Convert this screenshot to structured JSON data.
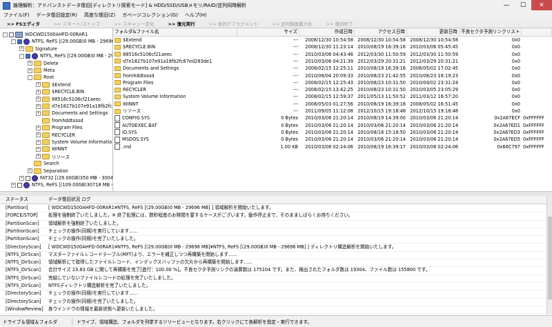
{
  "window": {
    "title": "論理解析：アドバンストデータ復旧[ディレクトリ探索モード] & HDD/SSD/USBメモリ/RAID/並列同時解析",
    "minimize": "—",
    "maximize": "☐",
    "close": "✕"
  },
  "menu": [
    "ファイル(F)",
    "データ復旧設定(R)",
    "高度な復旧(Z)",
    "ガベージコレクション(G)",
    "ヘルプ(H)"
  ],
  "toolbar": [
    {
      "label": ">> FSエディタ",
      "active": true
    },
    {
      "label": ">> スタート/ストップ",
      "active": false
    },
    {
      "label": ">> スキャン一定化",
      "active": false
    },
    {
      "label": ">> 復元実行",
      "active": true
    },
    {
      "label": ">> 並列デフラグメント",
      "active": false
    },
    {
      "label": ">> 並列階層最大化",
      "active": false
    },
    {
      "label": ">> 復旧終了",
      "active": false
    }
  ],
  "tree": [
    {
      "label": "WDCWD1500AHFD-00RAR1",
      "level": 0,
      "type": "drive",
      "pm": "-"
    },
    {
      "label": "NTFS, ReFS [(29.00GB)0 MB - 29696",
      "level": 1,
      "type": "part",
      "pm": "-",
      "checked": true
    },
    {
      "label": "Signature",
      "level": 2,
      "type": "folder",
      "pm": "+"
    },
    {
      "label": "NTFS, ReFS [(29.00GB)0 MB - 296",
      "level": 2,
      "type": "part",
      "pm": "-",
      "checked": true
    },
    {
      "label": "Delete",
      "level": 3,
      "type": "folder",
      "pm": "+"
    },
    {
      "label": "Meta",
      "level": 3,
      "type": "folder",
      "pm": "+"
    },
    {
      "label": "Root",
      "level": 3,
      "type": "folder",
      "pm": "-"
    },
    {
      "label": "$Extend",
      "level": 4,
      "type": "folder",
      "pm": "+"
    },
    {
      "label": "$RECYCLE.BIN",
      "level": 4,
      "type": "folder",
      "pm": "+"
    },
    {
      "label": "88516c5106cf21aeec",
      "level": 4,
      "type": "folder",
      "pm": "+"
    },
    {
      "label": "d7e1827b107e91a18fb2fc67",
      "level": 4,
      "type": "folder",
      "pm": "+"
    },
    {
      "label": "Documents and Settings",
      "level": 4,
      "type": "folder",
      "pm": "+"
    },
    {
      "label": "fromhddtossd",
      "level": 4,
      "type": "folder",
      "pm": ""
    },
    {
      "label": "Program Files",
      "level": 4,
      "type": "folder",
      "pm": "+"
    },
    {
      "label": "RECYCLER",
      "level": 4,
      "type": "folder",
      "pm": "+"
    },
    {
      "label": "System Volume Informatio",
      "level": 4,
      "type": "folder",
      "pm": "+"
    },
    {
      "label": "WINNT",
      "level": 4,
      "type": "folder",
      "pm": "+"
    },
    {
      "label": "リソース",
      "level": 4,
      "type": "folder",
      "pm": "+"
    },
    {
      "label": "Search",
      "level": 3,
      "type": "folder",
      "pm": ""
    },
    {
      "label": "Separation",
      "level": 3,
      "type": "folder",
      "pm": "+"
    },
    {
      "label": "FAT32 [(29.00GB)350 MB - 30046",
      "level": 2,
      "type": "part",
      "pm": "+",
      "checked": false
    },
    {
      "label": "NTFS, ReFS [(109.00GB)30718 MB -",
      "level": 1,
      "type": "part",
      "pm": "+",
      "checked": false
    }
  ],
  "filelist": {
    "headers": [
      "フォルダ&ファイル名",
      "サイズ",
      "作成日時",
      "アクセス日時",
      "更新日時",
      "不良セクタ予測リンクリスト",
      ""
    ],
    "rows": [
      {
        "icon": "folder",
        "name": "$Extend",
        "size": "---",
        "created": "2008/12/30 10:54:58",
        "accessed": "2008/12/30 10:54:58",
        "modified": "2008/12/30 10:54:58",
        "bad": "0x0",
        "extra": ""
      },
      {
        "icon": "folder",
        "name": "$RECYCLE.BIN",
        "size": "---",
        "created": "2008/12/30 11:23:14",
        "accessed": "2010/08/19 16:39:16",
        "modified": "2010/03/06 05:45:45",
        "bad": "0x0",
        "extra": ""
      },
      {
        "icon": "folder",
        "name": "88516c5106cf21aeec",
        "size": "---",
        "created": "2010/03/06 04:43:46",
        "accessed": "2012/03/30 11:50:59",
        "modified": "2012/03/30 11:50:59",
        "bad": "0x0",
        "extra": ""
      },
      {
        "icon": "folder",
        "name": "d7e1827b107e91a18fb2fc67ed283de1",
        "size": "---",
        "created": "2010/03/06 04:21:39",
        "accessed": "2012/03/29 20:31:21",
        "modified": "2012/03/29 20:31:21",
        "bad": "0x0",
        "extra": ""
      },
      {
        "icon": "folder",
        "name": "Documents and Settings",
        "size": "---",
        "created": "2008/02/15 12:25:11",
        "accessed": "2010/08/19 16:39:16",
        "modified": "2008/05/02 17:02:45",
        "bad": "0x0",
        "extra": ""
      },
      {
        "icon": "folder",
        "name": "fromhddtossd",
        "size": "---",
        "created": "2010/08/04 20:09:33",
        "accessed": "2010/08/23 21:42:55",
        "modified": "2010/08/23 18:19:23",
        "bad": "0x0",
        "extra": ""
      },
      {
        "icon": "folder",
        "name": "Program Files",
        "size": "---",
        "created": "2008/02/15 12:25:43",
        "accessed": "2010/08/23 10:31:50",
        "modified": "2010/04/02 23:31:24",
        "bad": "0x0",
        "extra": ""
      },
      {
        "icon": "folder",
        "name": "RECYCLER",
        "size": "---",
        "created": "2008/02/15 13:42:25",
        "accessed": "2010/08/23 10:31:50",
        "modified": "2010/03/05 23:05:29",
        "bad": "0x0",
        "extra": ""
      },
      {
        "icon": "folder",
        "name": "System Volume Information",
        "size": "---",
        "created": "2008/02/15 12:59:37",
        "accessed": "2011/05/13 11:50:52",
        "modified": "2011/03/12 16:57:20",
        "bad": "0x0",
        "extra": ""
      },
      {
        "icon": "folder",
        "name": "WINNT",
        "size": "---",
        "created": "2008/05/03 01:27:56",
        "accessed": "2010/08/19 16:39:16",
        "modified": "2008/05/02 16:51:45",
        "bad": "0x0",
        "extra": ""
      },
      {
        "icon": "folder",
        "name": "リソース",
        "size": "---",
        "created": "2011/09/05 11:12:08",
        "accessed": "2012/10/15 19:18:48",
        "modified": "2012/10/15 19:18:48",
        "bad": "0x0",
        "extra": ""
      },
      {
        "icon": "file",
        "name": "CONFIG.SYS",
        "size": "0 Bytes",
        "created": "2010/03/06 21:20:14",
        "accessed": "2010/08/19 14:39:00",
        "modified": "2010/03/06 21:20:14",
        "bad": "0x2A67ECF",
        "extra": "0xFFFFFF"
      },
      {
        "icon": "file",
        "name": "AUTOEXEC.BAT",
        "size": "0 Bytes",
        "created": "2010/03/06 21:20:14",
        "accessed": "2010/03/06 21:20:14",
        "modified": "2010/03/06 21:20:14",
        "bad": "0x2A67ED1",
        "extra": "0xFFFFFF"
      },
      {
        "icon": "file",
        "name": "IO.SYS",
        "size": "0 Bytes",
        "created": "2010/03/06 21:20:14",
        "accessed": "2010/08/16 15:18:50",
        "modified": "2010/03/06 21:20:14",
        "bad": "0x2A67ED3",
        "extra": "0xFFFFFF"
      },
      {
        "icon": "file",
        "name": "MSDOS.SYS",
        "size": "0 Bytes",
        "created": "2010/03/06 21:20:14",
        "accessed": "2010/03/06 21:20:14",
        "modified": "2010/03/06 21:20:14",
        "bad": "0x2A67ED5",
        "extra": "0xFFFFFF"
      },
      {
        "icon": "file",
        "name": ".rnd",
        "size": "1.00 KB",
        "created": "2010/03/08 02:24:06",
        "accessed": "2010/08/19 16:39:17",
        "modified": "2010/03/08 02:24:06",
        "bad": "0x66C797",
        "extra": "0xFFFFFF"
      }
    ]
  },
  "log": {
    "headers": [
      "ステータス",
      "データ復旧状況 ログ"
    ],
    "rows": [
      {
        "status": "[Partition]",
        "msg": "[ WDCWD1500AHFD-00RAR1¥NTFS, ReFS [(29.00GB)0 MB - 29696 MB] ] 領域解析を開始いたします。"
      },
      {
        "status": "[FORCE/STOP]",
        "msg": "処理を強制終了いたしました。※ 終了処理には、数秒程度のお時間を要するケースがございます。動作停止まで、そのまましばらくお待ちください。"
      },
      {
        "status": "[PartitionScan]",
        "msg": "領域解析を強制終了いたしました。"
      },
      {
        "status": "[PartitionScan]",
        "msg": "チェックの操作(同期)を実行しています......"
      },
      {
        "status": "[PartitionScan]",
        "msg": "チェックの操作(同期)を完了いたしました。"
      },
      {
        "status": "[DirectoryScan]",
        "msg": "[ WDCWD1500AHFD-00RAR1¥NTFS, ReFS [(29.00GB)0 MB - 29696 MB]¥NTFS, ReFS [(29.00GB)0 MB - 29696 MB] ] ディレクトリ構造解析を開始いたします。"
      },
      {
        "status": "[NTFS_DirScan]",
        "msg": "マスターファイルレコードテーブル(MFT)より、エラーを補正しつつ再構築を開始します......"
      },
      {
        "status": "[NTFS_DirScan]",
        "msg": "領域解析にて取得したファイルレコード、インデックスバッファの欠片から再構築を開始します......"
      },
      {
        "status": "[NTFS_DirScan]",
        "msg": "合計サイズ 23.83 GB に関して再構築を完了[進行：100.00 %]。不良セクタ予測リンクの演算数は 175104 です。また、検出されたフォルダ数は 19304、ファイル数は 155800 です。"
      },
      {
        "status": "[NTFS_DirScan]",
        "msg": "完結していないファイルレコードの処理を完了いたしました。"
      },
      {
        "status": "[NTFS_DirScan]",
        "msg": "NTFSディレクトリ構造解析を完了いたしました。"
      },
      {
        "status": "[DirectoryScan]",
        "msg": "チェックの操作(同期)を実行しています......"
      },
      {
        "status": "[DirectoryScan]",
        "msg": "チェックの操作(同期)を完了いたしました。"
      },
      {
        "status": "[WindowReview]",
        "msg": "各ウインドウの情報を最新状態へ更新いたしました。"
      }
    ]
  },
  "status": {
    "left": "ドライブ＆領域＆フォルダ",
    "right": "ドライブ、領域構造、フォルダを列挙するツリービューとなります。右クリックにて各解析を指定・実行できます。"
  }
}
